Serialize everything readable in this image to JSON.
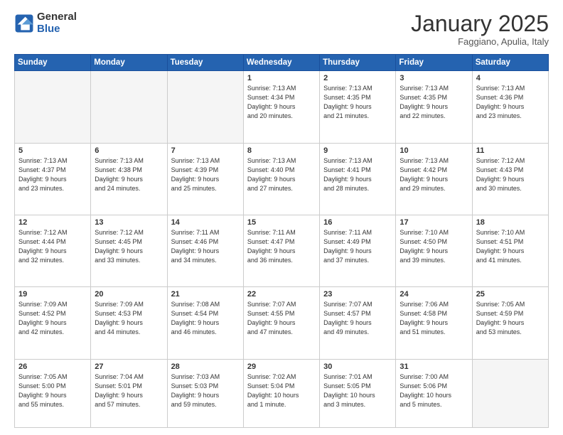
{
  "header": {
    "logo_general": "General",
    "logo_blue": "Blue",
    "month_title": "January 2025",
    "location": "Faggiano, Apulia, Italy"
  },
  "weekdays": [
    "Sunday",
    "Monday",
    "Tuesday",
    "Wednesday",
    "Thursday",
    "Friday",
    "Saturday"
  ],
  "weeks": [
    [
      {
        "day": "",
        "info": ""
      },
      {
        "day": "",
        "info": ""
      },
      {
        "day": "",
        "info": ""
      },
      {
        "day": "1",
        "info": "Sunrise: 7:13 AM\nSunset: 4:34 PM\nDaylight: 9 hours\nand 20 minutes."
      },
      {
        "day": "2",
        "info": "Sunrise: 7:13 AM\nSunset: 4:35 PM\nDaylight: 9 hours\nand 21 minutes."
      },
      {
        "day": "3",
        "info": "Sunrise: 7:13 AM\nSunset: 4:35 PM\nDaylight: 9 hours\nand 22 minutes."
      },
      {
        "day": "4",
        "info": "Sunrise: 7:13 AM\nSunset: 4:36 PM\nDaylight: 9 hours\nand 23 minutes."
      }
    ],
    [
      {
        "day": "5",
        "info": "Sunrise: 7:13 AM\nSunset: 4:37 PM\nDaylight: 9 hours\nand 23 minutes."
      },
      {
        "day": "6",
        "info": "Sunrise: 7:13 AM\nSunset: 4:38 PM\nDaylight: 9 hours\nand 24 minutes."
      },
      {
        "day": "7",
        "info": "Sunrise: 7:13 AM\nSunset: 4:39 PM\nDaylight: 9 hours\nand 25 minutes."
      },
      {
        "day": "8",
        "info": "Sunrise: 7:13 AM\nSunset: 4:40 PM\nDaylight: 9 hours\nand 27 minutes."
      },
      {
        "day": "9",
        "info": "Sunrise: 7:13 AM\nSunset: 4:41 PM\nDaylight: 9 hours\nand 28 minutes."
      },
      {
        "day": "10",
        "info": "Sunrise: 7:13 AM\nSunset: 4:42 PM\nDaylight: 9 hours\nand 29 minutes."
      },
      {
        "day": "11",
        "info": "Sunrise: 7:12 AM\nSunset: 4:43 PM\nDaylight: 9 hours\nand 30 minutes."
      }
    ],
    [
      {
        "day": "12",
        "info": "Sunrise: 7:12 AM\nSunset: 4:44 PM\nDaylight: 9 hours\nand 32 minutes."
      },
      {
        "day": "13",
        "info": "Sunrise: 7:12 AM\nSunset: 4:45 PM\nDaylight: 9 hours\nand 33 minutes."
      },
      {
        "day": "14",
        "info": "Sunrise: 7:11 AM\nSunset: 4:46 PM\nDaylight: 9 hours\nand 34 minutes."
      },
      {
        "day": "15",
        "info": "Sunrise: 7:11 AM\nSunset: 4:47 PM\nDaylight: 9 hours\nand 36 minutes."
      },
      {
        "day": "16",
        "info": "Sunrise: 7:11 AM\nSunset: 4:49 PM\nDaylight: 9 hours\nand 37 minutes."
      },
      {
        "day": "17",
        "info": "Sunrise: 7:10 AM\nSunset: 4:50 PM\nDaylight: 9 hours\nand 39 minutes."
      },
      {
        "day": "18",
        "info": "Sunrise: 7:10 AM\nSunset: 4:51 PM\nDaylight: 9 hours\nand 41 minutes."
      }
    ],
    [
      {
        "day": "19",
        "info": "Sunrise: 7:09 AM\nSunset: 4:52 PM\nDaylight: 9 hours\nand 42 minutes."
      },
      {
        "day": "20",
        "info": "Sunrise: 7:09 AM\nSunset: 4:53 PM\nDaylight: 9 hours\nand 44 minutes."
      },
      {
        "day": "21",
        "info": "Sunrise: 7:08 AM\nSunset: 4:54 PM\nDaylight: 9 hours\nand 46 minutes."
      },
      {
        "day": "22",
        "info": "Sunrise: 7:07 AM\nSunset: 4:55 PM\nDaylight: 9 hours\nand 47 minutes."
      },
      {
        "day": "23",
        "info": "Sunrise: 7:07 AM\nSunset: 4:57 PM\nDaylight: 9 hours\nand 49 minutes."
      },
      {
        "day": "24",
        "info": "Sunrise: 7:06 AM\nSunset: 4:58 PM\nDaylight: 9 hours\nand 51 minutes."
      },
      {
        "day": "25",
        "info": "Sunrise: 7:05 AM\nSunset: 4:59 PM\nDaylight: 9 hours\nand 53 minutes."
      }
    ],
    [
      {
        "day": "26",
        "info": "Sunrise: 7:05 AM\nSunset: 5:00 PM\nDaylight: 9 hours\nand 55 minutes."
      },
      {
        "day": "27",
        "info": "Sunrise: 7:04 AM\nSunset: 5:01 PM\nDaylight: 9 hours\nand 57 minutes."
      },
      {
        "day": "28",
        "info": "Sunrise: 7:03 AM\nSunset: 5:03 PM\nDaylight: 9 hours\nand 59 minutes."
      },
      {
        "day": "29",
        "info": "Sunrise: 7:02 AM\nSunset: 5:04 PM\nDaylight: 10 hours\nand 1 minute."
      },
      {
        "day": "30",
        "info": "Sunrise: 7:01 AM\nSunset: 5:05 PM\nDaylight: 10 hours\nand 3 minutes."
      },
      {
        "day": "31",
        "info": "Sunrise: 7:00 AM\nSunset: 5:06 PM\nDaylight: 10 hours\nand 5 minutes."
      },
      {
        "day": "",
        "info": ""
      }
    ]
  ]
}
